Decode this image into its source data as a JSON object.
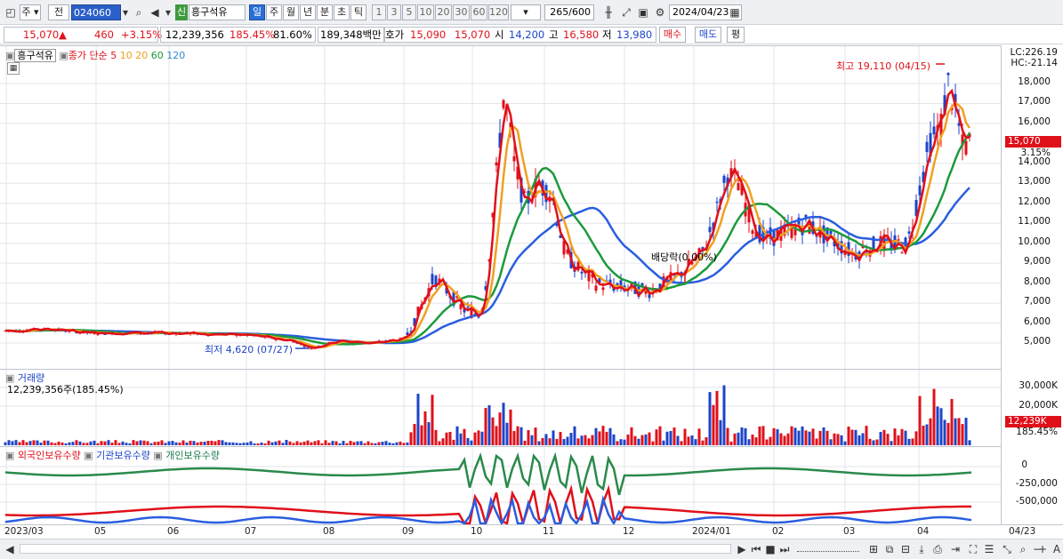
{
  "toolbar": {
    "market": "주",
    "price_type": "전",
    "code": "024060",
    "shin_badge": "신",
    "stock_name": "흥구석유",
    "periods": [
      "일",
      "주",
      "월",
      "년",
      "분",
      "초",
      "틱"
    ],
    "intervals": [
      "1",
      "3",
      "5",
      "10",
      "20",
      "30",
      "60",
      "120"
    ],
    "count": "265",
    "count_total": "/600",
    "date": "2024/04/23"
  },
  "quote": {
    "price": "15,070",
    "up_arrow": "▲",
    "change": "460",
    "change_pct": "+3.15%",
    "volume": "12,239,356",
    "volume_ratio": "185.45%",
    "turnover": "81.60%",
    "amount": "189,348백만",
    "hoga_label": "호가",
    "ask": "15,090",
    "bid": "15,070",
    "open_label": "시",
    "open": "14,200",
    "high_label": "고",
    "high": "16,580",
    "low_label": "저",
    "low": "13,980",
    "buy_button": "매수",
    "sell_button": "매도",
    "eval_button": "평"
  },
  "price_panel": {
    "legend_name": "흥구석유",
    "legend_ma_label": "종가 단순",
    "ma_periods": [
      "5",
      "10",
      "20",
      "60",
      "120"
    ],
    "ma_colors": [
      "#e0101a",
      "#f0a020",
      "#f0a020",
      "#1c9a3c",
      "#2a5ee0"
    ],
    "lc": "LC:226.19",
    "hc": "HC:-21.14",
    "high_annot": "최고 19,110 (04/15)",
    "low_annot": "최저 4,620 (07/27)",
    "div_annot": "배당락(0.00%)",
    "yticks": [
      "18,000",
      "17,000",
      "16,000",
      "14,000",
      "13,000",
      "12,000",
      "11,000",
      "10,000",
      "9,000",
      "8,000",
      "7,000",
      "6,000",
      "5,000"
    ],
    "price_tag": "15,070",
    "pct_tag": "3.15%"
  },
  "volume_panel": {
    "title": "거래량",
    "value": "12,239,356주(185.45%)",
    "yticks": [
      "30,000K",
      "20,000K"
    ],
    "tag": "12,239K",
    "pct": "185.45%"
  },
  "holding_panel": {
    "legend": [
      "외국인보유수량",
      "기관보유수량",
      "개인보유수량"
    ],
    "yticks": [
      "0",
      "-250,000",
      "-500,000"
    ]
  },
  "xaxis": {
    "labels": [
      "2023/03",
      "05",
      "06",
      "07",
      "08",
      "09",
      "10",
      "11",
      "12",
      "2024/01",
      "02",
      "03",
      "04"
    ],
    "right_label": "04/23"
  },
  "colors": {
    "up": "#e0101a",
    "down": "#1d44c8",
    "ma5": "#e0101a",
    "ma20": "#f0a020",
    "ma60": "#1c9a3c",
    "ma120": "#2a5ee0"
  }
}
